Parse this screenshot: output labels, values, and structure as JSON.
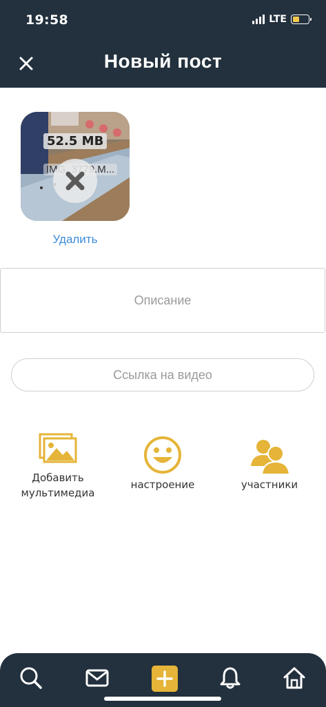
{
  "status_bar": {
    "time": "19:58",
    "network": "LTE",
    "battery_level": 0.45
  },
  "header": {
    "title": "Новый пост",
    "close_icon": "close-icon"
  },
  "media": {
    "size_label": "52.5 MB",
    "file_label": "IMG_3779.M...",
    "remove_icon": "remove-x-icon",
    "delete_label": "Удалить"
  },
  "description": {
    "placeholder": "Описание"
  },
  "video_link": {
    "placeholder": "Ссылка на видео"
  },
  "actions": [
    {
      "label_line1": "Добавить",
      "label_line2": "мультимедиа",
      "icon": "add-media-icon"
    },
    {
      "label": "настроение",
      "icon": "mood-smile-icon"
    },
    {
      "label": "участники",
      "icon": "participants-icon"
    }
  ],
  "tabbar": {
    "items": [
      "search-icon",
      "mail-icon",
      "add-post-icon",
      "bell-icon",
      "home-icon"
    ]
  },
  "colors": {
    "header_bg": "#23303d",
    "accent": "#e5b438",
    "link": "#3b8bd6"
  }
}
